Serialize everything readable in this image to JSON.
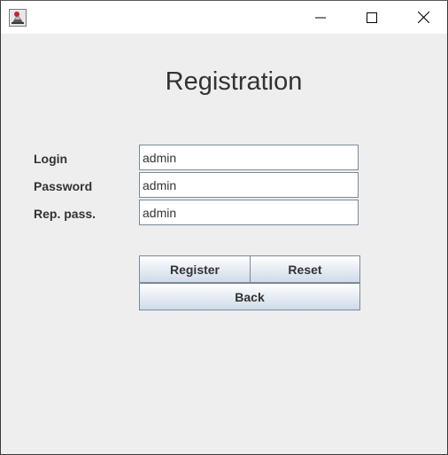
{
  "window": {
    "app_icon": "java-app-icon",
    "controls": {
      "minimize_icon": "minimize-icon",
      "maximize_icon": "maximize-icon",
      "close_icon": "close-icon"
    }
  },
  "form": {
    "title": "Registration",
    "fields": [
      {
        "label": "Login",
        "value": "admin"
      },
      {
        "label": "Password",
        "value": "admin"
      },
      {
        "label": "Rep. pass.",
        "value": "admin"
      }
    ],
    "buttons": {
      "register": "Register",
      "reset": "Reset",
      "back": "Back"
    }
  },
  "colors": {
    "background": "#eeeeee",
    "titlebar": "#ffffff",
    "text": "#333333",
    "button_border": "#7a8a99",
    "button_gradient_bottom": "#cfdbe9"
  }
}
